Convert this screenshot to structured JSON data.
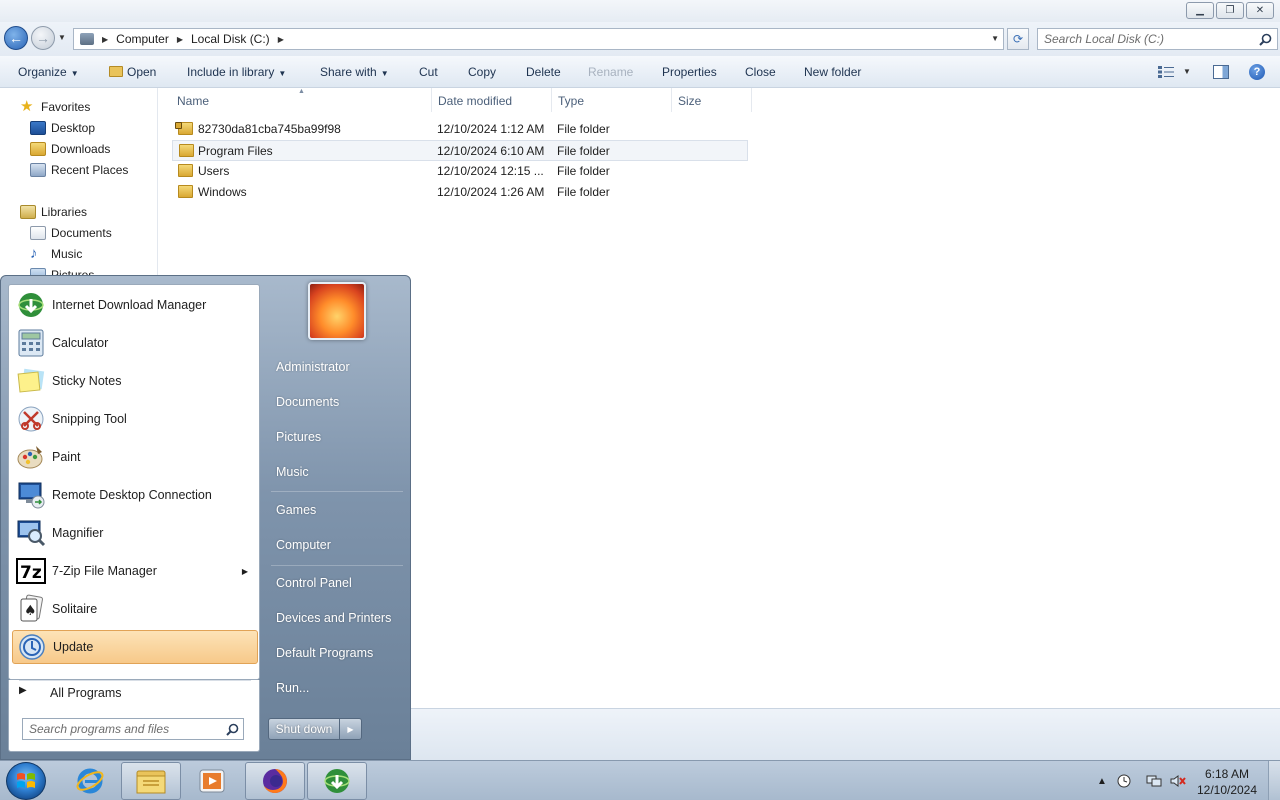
{
  "window": {
    "caption_buttons": [
      "minimize",
      "maximize",
      "close"
    ]
  },
  "address": {
    "breadcrumbs": [
      "Computer",
      "Local Disk (C:)"
    ],
    "search_placeholder": "Search Local Disk (C:)"
  },
  "toolbar": {
    "organize": "Organize",
    "open": "Open",
    "include_in_library": "Include in library",
    "share_with": "Share with",
    "cut": "Cut",
    "copy": "Copy",
    "delete": "Delete",
    "rename": "Rename",
    "properties": "Properties",
    "close": "Close",
    "new_folder": "New folder"
  },
  "navpane": {
    "favorites": "Favorites",
    "favorites_items": [
      "Desktop",
      "Downloads",
      "Recent Places"
    ],
    "libraries": "Libraries",
    "libraries_items": [
      "Documents",
      "Music",
      "Pictures"
    ]
  },
  "files": {
    "columns": [
      "Name",
      "Date modified",
      "Type",
      "Size"
    ],
    "rows": [
      {
        "name": "82730da81cba745ba99f98",
        "date": "12/10/2024 1:12 AM",
        "type": "File folder",
        "size": ""
      },
      {
        "name": "Program Files",
        "date": "12/10/2024 6:10 AM",
        "type": "File folder",
        "size": ""
      },
      {
        "name": "Users",
        "date": "12/10/2024 12:15 ...",
        "type": "File folder",
        "size": ""
      },
      {
        "name": "Windows",
        "date": "12/10/2024 1:26 AM",
        "type": "File folder",
        "size": ""
      }
    ]
  },
  "start_menu": {
    "programs": [
      {
        "label": "Internet Download Manager",
        "icon": "idm-icon"
      },
      {
        "label": "Calculator",
        "icon": "calculator-icon"
      },
      {
        "label": "Sticky Notes",
        "icon": "sticky-notes-icon"
      },
      {
        "label": "Snipping Tool",
        "icon": "snipping-tool-icon"
      },
      {
        "label": "Paint",
        "icon": "paint-icon"
      },
      {
        "label": "Remote Desktop Connection",
        "icon": "remote-desktop-icon"
      },
      {
        "label": "Magnifier",
        "icon": "magnifier-icon"
      },
      {
        "label": "7-Zip File Manager",
        "icon": "7zip-icon"
      },
      {
        "label": "Solitaire",
        "icon": "solitaire-icon"
      },
      {
        "label": "Update",
        "icon": "update-icon"
      }
    ],
    "all_programs": "All Programs",
    "search_placeholder": "Search programs and files",
    "right_items": [
      "Administrator",
      "Documents",
      "Pictures",
      "Music",
      "Games",
      "Computer",
      "Control Panel",
      "Devices and Printers",
      "Default Programs",
      "Run..."
    ],
    "shutdown": "Shut down"
  },
  "taskbar": {
    "pinned": [
      "internet-explorer-icon",
      "windows-explorer-icon",
      "media-player-icon",
      "firefox-icon",
      "idm-icon"
    ],
    "clock_time": "6:18 AM",
    "clock_date": "12/10/2024"
  },
  "colors": {
    "accent": "#2a64b6",
    "highlight": "#f7c98a",
    "start_menu_right": "#7f94ac"
  }
}
